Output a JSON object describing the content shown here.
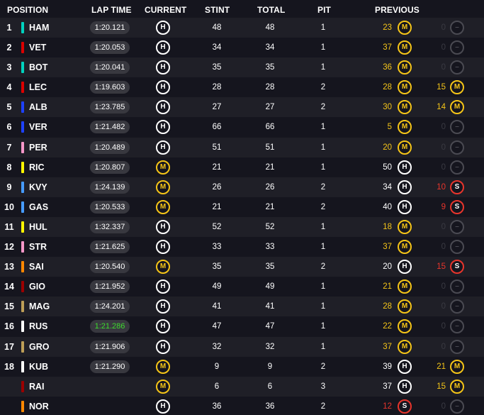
{
  "header": {
    "position": "POSITION",
    "lap_time": "LAP TIME",
    "current": "CURRENT",
    "stint": "STINT",
    "total": "TOTAL",
    "pit": "PIT",
    "previous": "PREVIOUS"
  },
  "colors": {
    "background": "#15151e",
    "row_alt": "#1f1f27",
    "hard": "#ffffff",
    "medium": "#f5c518",
    "soft": "#e8352c",
    "fastest": "#3ddc2e",
    "mercedes": "#00d2be",
    "ferrari": "#dc0000",
    "red_bull": "#1e41ff",
    "racing_point": "#f596c8",
    "renault": "#fff500",
    "toro_rosso": "#469bff",
    "haas": "#bd9e57",
    "mclaren": "#ff8700",
    "alfa_romeo": "#9b0000",
    "williams": "#ffffff"
  },
  "rows": [
    {
      "pos": "1",
      "driver": "HAM",
      "team": "#00d2be",
      "lap": "1:20.121",
      "best": false,
      "current": "H",
      "stint": "48",
      "total": "48",
      "pit": "1",
      "p1": "23",
      "p1t": "M",
      "p2": "0",
      "p2t": "E"
    },
    {
      "pos": "2",
      "driver": "VET",
      "team": "#dc0000",
      "lap": "1:20.053",
      "best": false,
      "current": "H",
      "stint": "34",
      "total": "34",
      "pit": "1",
      "p1": "37",
      "p1t": "M",
      "p2": "0",
      "p2t": "E"
    },
    {
      "pos": "3",
      "driver": "BOT",
      "team": "#00d2be",
      "lap": "1:20.041",
      "best": false,
      "current": "H",
      "stint": "35",
      "total": "35",
      "pit": "1",
      "p1": "36",
      "p1t": "M",
      "p2": "0",
      "p2t": "E"
    },
    {
      "pos": "4",
      "driver": "LEC",
      "team": "#dc0000",
      "lap": "1:19.603",
      "best": false,
      "current": "H",
      "stint": "28",
      "total": "28",
      "pit": "2",
      "p1": "28",
      "p1t": "M",
      "p2": "15",
      "p2t": "M"
    },
    {
      "pos": "5",
      "driver": "ALB",
      "team": "#1e41ff",
      "lap": "1:23.785",
      "best": false,
      "current": "H",
      "stint": "27",
      "total": "27",
      "pit": "2",
      "p1": "30",
      "p1t": "M",
      "p2": "14",
      "p2t": "M"
    },
    {
      "pos": "6",
      "driver": "VER",
      "team": "#1e41ff",
      "lap": "1:21.482",
      "best": false,
      "current": "H",
      "stint": "66",
      "total": "66",
      "pit": "1",
      "p1": "5",
      "p1t": "M",
      "p2": "0",
      "p2t": "E"
    },
    {
      "pos": "7",
      "driver": "PER",
      "team": "#f596c8",
      "lap": "1:20.489",
      "best": false,
      "current": "H",
      "stint": "51",
      "total": "51",
      "pit": "1",
      "p1": "20",
      "p1t": "M",
      "p2": "0",
      "p2t": "E"
    },
    {
      "pos": "8",
      "driver": "RIC",
      "team": "#fff500",
      "lap": "1:20.807",
      "best": false,
      "current": "M",
      "stint": "21",
      "total": "21",
      "pit": "1",
      "p1": "50",
      "p1t": "H",
      "p2": "0",
      "p2t": "E"
    },
    {
      "pos": "9",
      "driver": "KVY",
      "team": "#469bff",
      "lap": "1:24.139",
      "best": false,
      "current": "M",
      "stint": "26",
      "total": "26",
      "pit": "2",
      "p1": "34",
      "p1t": "H",
      "p2": "10",
      "p2t": "S"
    },
    {
      "pos": "10",
      "driver": "GAS",
      "team": "#469bff",
      "lap": "1:20.533",
      "best": false,
      "current": "M",
      "stint": "21",
      "total": "21",
      "pit": "2",
      "p1": "40",
      "p1t": "H",
      "p2": "9",
      "p2t": "S"
    },
    {
      "pos": "11",
      "driver": "HUL",
      "team": "#fff500",
      "lap": "1:32.337",
      "best": false,
      "current": "H",
      "stint": "52",
      "total": "52",
      "pit": "1",
      "p1": "18",
      "p1t": "M",
      "p2": "0",
      "p2t": "E"
    },
    {
      "pos": "12",
      "driver": "STR",
      "team": "#f596c8",
      "lap": "1:21.625",
      "best": false,
      "current": "H",
      "stint": "33",
      "total": "33",
      "pit": "1",
      "p1": "37",
      "p1t": "M",
      "p2": "0",
      "p2t": "E"
    },
    {
      "pos": "13",
      "driver": "SAI",
      "team": "#ff8700",
      "lap": "1:20.540",
      "best": false,
      "current": "M",
      "stint": "35",
      "total": "35",
      "pit": "2",
      "p1": "20",
      "p1t": "H",
      "p2": "15",
      "p2t": "S"
    },
    {
      "pos": "14",
      "driver": "GIO",
      "team": "#9b0000",
      "lap": "1:21.952",
      "best": false,
      "current": "H",
      "stint": "49",
      "total": "49",
      "pit": "1",
      "p1": "21",
      "p1t": "M",
      "p2": "0",
      "p2t": "E"
    },
    {
      "pos": "15",
      "driver": "MAG",
      "team": "#bd9e57",
      "lap": "1:24.201",
      "best": false,
      "current": "H",
      "stint": "41",
      "total": "41",
      "pit": "1",
      "p1": "28",
      "p1t": "M",
      "p2": "0",
      "p2t": "E"
    },
    {
      "pos": "16",
      "driver": "RUS",
      "team": "#ffffff",
      "lap": "1:21.286",
      "best": true,
      "current": "H",
      "stint": "47",
      "total": "47",
      "pit": "1",
      "p1": "22",
      "p1t": "M",
      "p2": "0",
      "p2t": "E"
    },
    {
      "pos": "17",
      "driver": "GRO",
      "team": "#bd9e57",
      "lap": "1:21.906",
      "best": false,
      "current": "H",
      "stint": "32",
      "total": "32",
      "pit": "1",
      "p1": "37",
      "p1t": "M",
      "p2": "0",
      "p2t": "E"
    },
    {
      "pos": "18",
      "driver": "KUB",
      "team": "#ffffff",
      "lap": "1:21.290",
      "best": false,
      "current": "M",
      "stint": "9",
      "total": "9",
      "pit": "2",
      "p1": "39",
      "p1t": "H",
      "p2": "21",
      "p2t": "M"
    },
    {
      "pos": "",
      "driver": "RAI",
      "team": "#9b0000",
      "lap": "",
      "best": false,
      "current": "M",
      "stint": "6",
      "total": "6",
      "pit": "3",
      "p1": "37",
      "p1t": "H",
      "p2": "15",
      "p2t": "M"
    },
    {
      "pos": "",
      "driver": "NOR",
      "team": "#ff8700",
      "lap": "",
      "best": false,
      "current": "H",
      "stint": "36",
      "total": "36",
      "pit": "2",
      "p1": "12",
      "p1t": "S",
      "p2": "0",
      "p2t": "E"
    }
  ]
}
